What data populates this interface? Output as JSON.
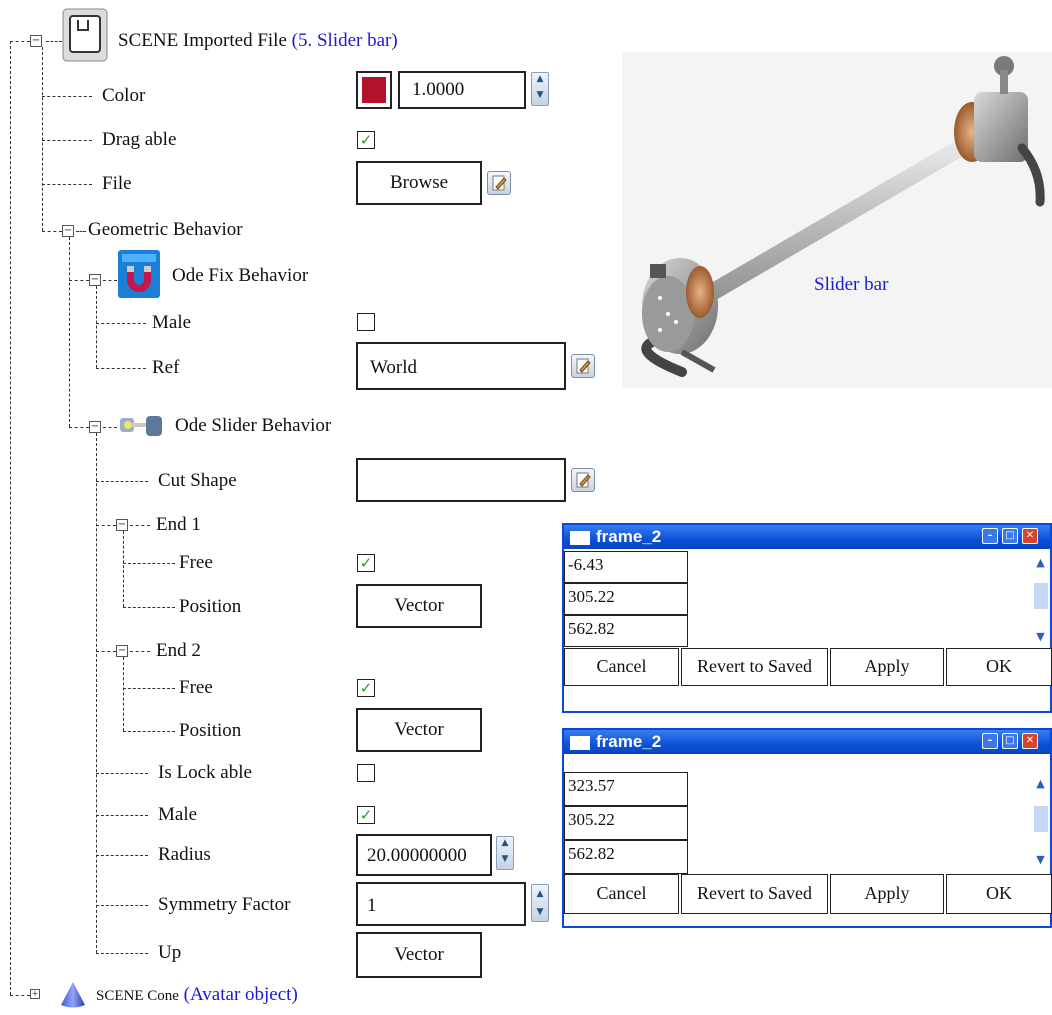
{
  "tree": {
    "root": {
      "name": "SCENE Imported File",
      "annotation": "(5. Slider bar)"
    },
    "color": {
      "label": "Color",
      "value": "1.0000",
      "swatch": "#b3122a"
    },
    "draggable": {
      "label": "Drag able",
      "checked": true
    },
    "file": {
      "label": "File",
      "button": "Browse"
    },
    "geometric": {
      "label": "Geometric Behavior"
    },
    "ode_fix": {
      "label": "Ode Fix Behavior"
    },
    "male1": {
      "label": "Male",
      "checked": false
    },
    "ref": {
      "label": "Ref",
      "value": "World"
    },
    "ode_slider": {
      "label": "Ode Slider Behavior"
    },
    "cut_shape": {
      "label": "Cut Shape",
      "value": ""
    },
    "end1": {
      "label": "End 1"
    },
    "end1_free": {
      "label": "Free",
      "checked": true
    },
    "end1_position": {
      "label": "Position",
      "button": "Vector"
    },
    "end2": {
      "label": "End 2"
    },
    "end2_free": {
      "label": "Free",
      "checked": true
    },
    "end2_position": {
      "label": "Position",
      "button": "Vector"
    },
    "is_lockable": {
      "label": "Is Lock able",
      "checked": false
    },
    "male2": {
      "label": "Male",
      "checked": true
    },
    "radius": {
      "label": "Radius",
      "value": "20.00000000"
    },
    "symmetry": {
      "label": "Symmetry Factor",
      "value": "1"
    },
    "up": {
      "label": "Up",
      "button": "Vector"
    },
    "cone": {
      "name": "SCENE Cone",
      "annotation": "(Avatar object)"
    }
  },
  "image_caption": "Slider bar",
  "frames": [
    {
      "title": "frame_2",
      "values": [
        "-6.43",
        "305.22",
        "562.82"
      ],
      "buttons": {
        "cancel": "Cancel",
        "revert": "Revert to Saved",
        "apply": "Apply",
        "ok": "OK"
      }
    },
    {
      "title": "frame_2",
      "values": [
        "323.57",
        "305.22",
        "562.82"
      ],
      "buttons": {
        "cancel": "Cancel",
        "revert": "Revert to Saved",
        "apply": "Apply",
        "ok": "OK"
      }
    }
  ],
  "icons": {
    "root": "scene-file-icon",
    "ode_fix": "magnet-icon",
    "ode_slider": "slider-behavior-icon",
    "cone": "cone-icon",
    "edit": "edit-icon",
    "spin": "spinner-icon"
  }
}
